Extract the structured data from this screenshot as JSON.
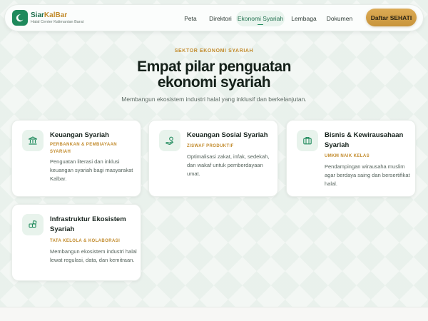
{
  "header": {
    "brand_main": "Siar",
    "brand_accent": "KalBar",
    "brand_sub": "Halal Center Kalimantan Barat",
    "nav": [
      {
        "label": "Peta"
      },
      {
        "label": "Direktori"
      },
      {
        "label": "Ekonomi Syariah",
        "active": true
      },
      {
        "label": "Lembaga"
      },
      {
        "label": "Dokumen"
      }
    ],
    "cta_label": "Daftar SEHATI"
  },
  "hero": {
    "eyebrow": "SEKTOR EKONOMI SYARIAH",
    "title": "Empat pilar penguatan ekonomi syariah",
    "subtitle": "Membangun ekosistem industri halal yang inklusif dan berkelanjutan."
  },
  "cards": [
    {
      "icon": "bank-icon",
      "title": "Keuangan Syariah",
      "tag": "PERBANKAN & PEMBIAYAAN SYARIAH",
      "description": "Penguatan literasi dan inklusi keuangan syariah bagi masyarakat Kalbar."
    },
    {
      "icon": "hand-coin-icon",
      "title": "Keuangan Sosial Syariah",
      "tag": "ZISWAF PRODUKTIF",
      "description": "Optimalisasi zakat, infak, sedekah, dan wakaf untuk pemberdayaan umat."
    },
    {
      "icon": "briefcase-icon",
      "title": "Bisnis & Kewirausahaan Syariah",
      "tag": "UMKM NAIK KELAS",
      "description": "Pendampingan wirausaha muslim agar berdaya saing dan bersertifikat halal."
    },
    {
      "icon": "blocks-icon",
      "title": "Infrastruktur Ekosistem Syariah",
      "tag": "TATA KELOLA & KOLABORASI",
      "description": "Membangun ekosistem industri halal lewat regulasi, data, dan kemitraan."
    }
  ],
  "colors": {
    "primary": "#1f8a5c",
    "accent": "#c28b2c",
    "cta": "#d4a24a"
  }
}
